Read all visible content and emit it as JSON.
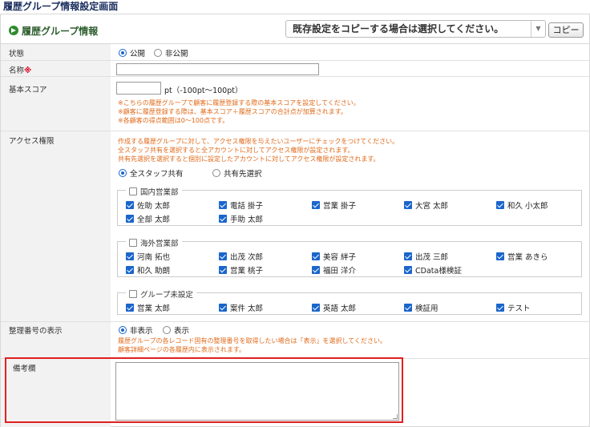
{
  "page_title": "履歴グループ情報設定画面",
  "header": {
    "title": "履歴グループ情報",
    "copy_select_value": "既存設定をコピーする場合は選択してください。",
    "copy_button": "コピー"
  },
  "labels": {
    "status": "状態",
    "name": "名称",
    "required_mark": "※",
    "base_score": "基本スコア",
    "access": "アクセス権限",
    "serial_display": "整理番号の表示",
    "notes": "備考欄"
  },
  "status": {
    "options": [
      "公開",
      "非公開"
    ],
    "selected": "公開"
  },
  "name": {
    "value": ""
  },
  "base_score": {
    "value": "",
    "unit_hint": "pt（-100pt～100pt）",
    "notes": [
      "※こちらの履歴グループで顧客に履歴登録する際の基本スコアを設定してください。",
      "※顧客に履歴登録する際は、基本スコア＋履歴スコアの合計点が加算されます。",
      "※各顧客の得点範囲は0～100点です。"
    ]
  },
  "access": {
    "notes": [
      "作成する履歴グループに対して、アクセス権限を与えたいユーザーにチェックをつけてください。",
      "全スタッフ共有を選択すると全アカウントに対してアクセス権限が設定されます。",
      "共有先選択を選択すると個別に設定したアカウントに対してアクセス権限が設定されます。"
    ],
    "options": [
      "全スタッフ共有",
      "共有先選択"
    ],
    "selected": "全スタッフ共有",
    "groups": [
      {
        "name": "国内営業部",
        "checked": false,
        "members": [
          "佐助 太郎",
          "電話 掛子",
          "営業 掛子",
          "大宮 太郎",
          "和久 小太郎",
          "全部 太郎",
          "手助 太郎"
        ]
      },
      {
        "name": "海外営業部",
        "checked": false,
        "members": [
          "河南 拓也",
          "出茂 次郎",
          "美容 絆子",
          "出茂 三郎",
          "営業 あきら",
          "和久 助朗",
          "営業 桃子",
          "福田 洋介",
          "CData様検証"
        ]
      },
      {
        "name": "グループ未設定",
        "checked": false,
        "members": [
          "営業 太郎",
          "案件 太郎",
          "英語 太郎",
          "検証用",
          "テスト"
        ]
      }
    ]
  },
  "serial_display": {
    "options": [
      "非表示",
      "表示"
    ],
    "selected": "非表示",
    "notes": [
      "履歴グループの各レコード固有の整理番号を取得したい場合は「表示」を選択してください。",
      "顧客詳細ページの各履歴内に表示されます。"
    ]
  },
  "notes_field": {
    "value": ""
  },
  "colors": {
    "title": "#1a2e5e",
    "accent_green": "#2e8b2e",
    "note_orange": "#e06a1a",
    "highlight_red": "#e02020",
    "check_blue": "#1a66cc"
  }
}
